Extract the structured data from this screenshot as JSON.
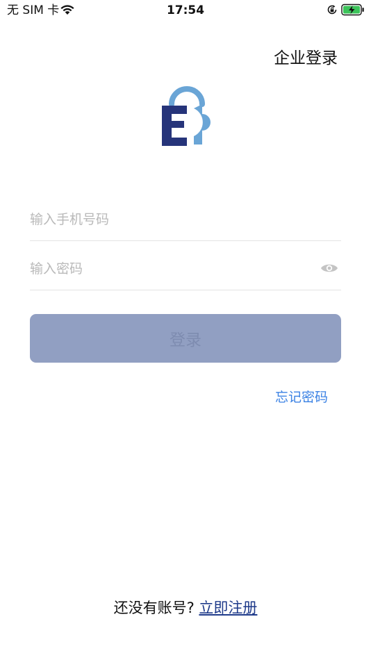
{
  "status_bar": {
    "carrier": "无 SIM 卡",
    "time": "17:54"
  },
  "header": {
    "enterprise_login": "企业登录"
  },
  "form": {
    "phone_placeholder": "输入手机号码",
    "password_placeholder": "输入密码",
    "login_label": "登录",
    "forgot_password": "忘记密码"
  },
  "footer": {
    "prompt": "还没有账号?",
    "register": "立即注册"
  },
  "colors": {
    "logo_dark": "#26347a",
    "logo_light": "#6aa5d6",
    "button_bg": "#919fc2",
    "link_blue": "#3b82e4",
    "register_blue": "#1e3a8a"
  }
}
